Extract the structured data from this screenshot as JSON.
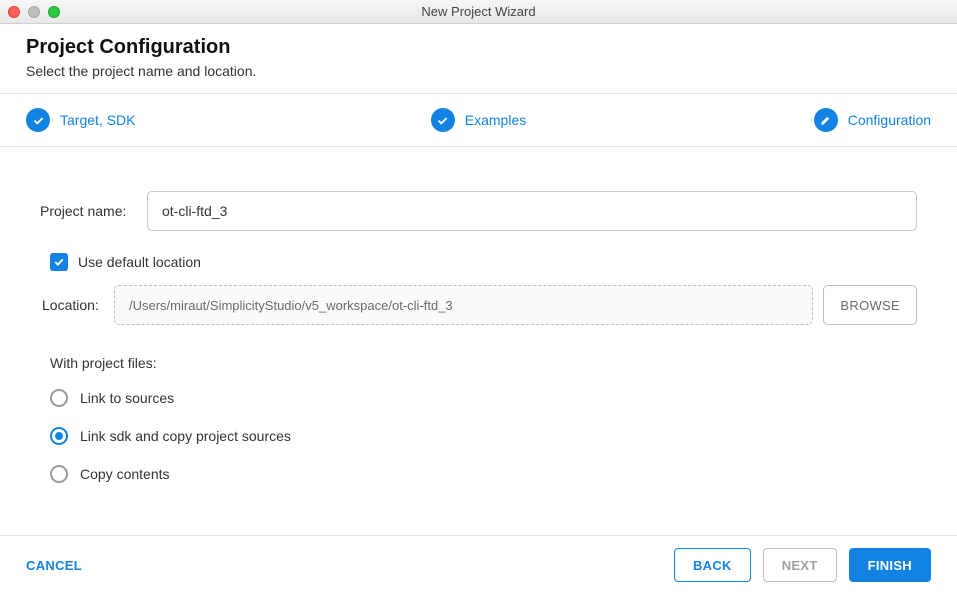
{
  "window_title": "New Project Wizard",
  "header": {
    "title": "Project Configuration",
    "subtitle": "Select the project name and location."
  },
  "stepper": {
    "step1": "Target, SDK",
    "step2": "Examples",
    "step3": "Configuration"
  },
  "form": {
    "project_name_label": "Project name:",
    "project_name_value": "ot-cli-ftd_3",
    "use_default_location_label": "Use default location",
    "use_default_location_checked": true,
    "location_label": "Location:",
    "location_value": "/Users/miraut/SimplicityStudio/v5_workspace/ot-cli-ftd_3",
    "browse_label": "BROWSE",
    "with_project_files_label": "With project files:",
    "radio_options": [
      {
        "label": "Link to sources",
        "selected": false
      },
      {
        "label": "Link sdk and copy project sources",
        "selected": true
      },
      {
        "label": "Copy contents",
        "selected": false
      }
    ]
  },
  "footer": {
    "cancel": "CANCEL",
    "back": "BACK",
    "next": "NEXT",
    "finish": "FINISH"
  }
}
